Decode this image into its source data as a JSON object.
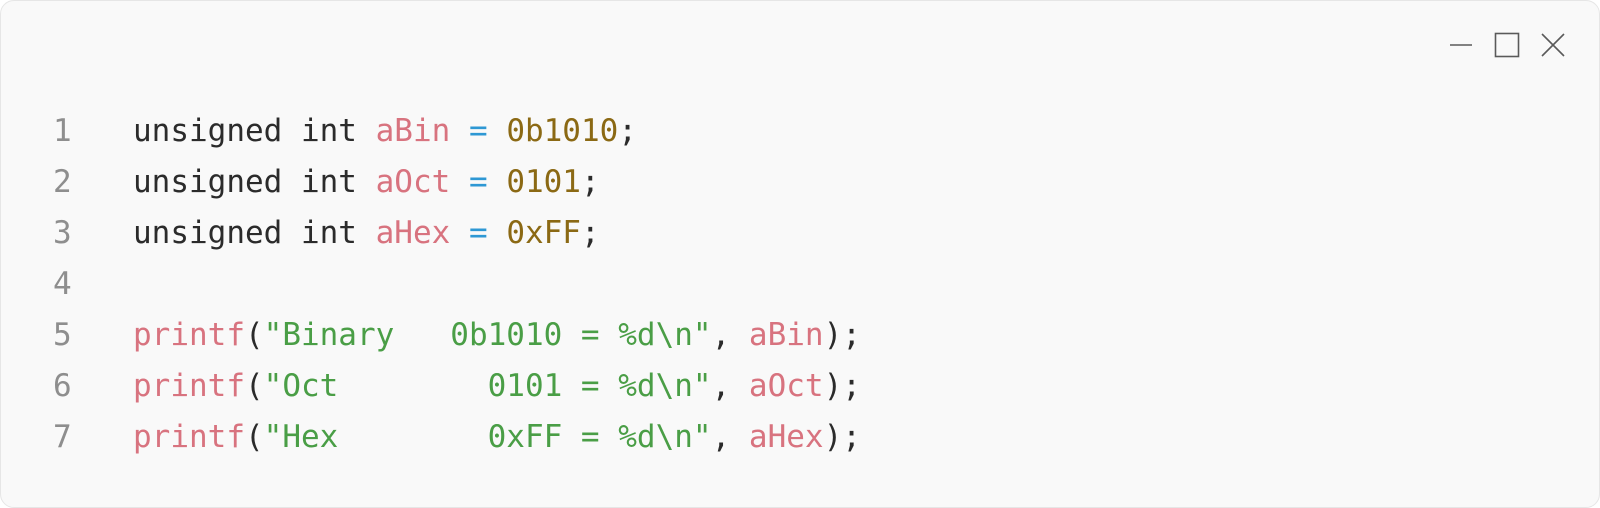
{
  "window": {
    "controls": {
      "minimize_icon": "minimize-icon",
      "maximize_icon": "maximize-icon",
      "close_icon": "close-icon"
    }
  },
  "editor": {
    "language": "C",
    "lines": [
      {
        "number": "1",
        "tokens": [
          {
            "text": "unsigned int ",
            "kind": "plain"
          },
          {
            "text": "aBin",
            "kind": "var"
          },
          {
            "text": " ",
            "kind": "plain"
          },
          {
            "text": "=",
            "kind": "op"
          },
          {
            "text": " ",
            "kind": "plain"
          },
          {
            "text": "0b1010",
            "kind": "num"
          },
          {
            "text": ";",
            "kind": "plain"
          }
        ]
      },
      {
        "number": "2",
        "tokens": [
          {
            "text": "unsigned int ",
            "kind": "plain"
          },
          {
            "text": "aOct",
            "kind": "var"
          },
          {
            "text": " ",
            "kind": "plain"
          },
          {
            "text": "=",
            "kind": "op"
          },
          {
            "text": " ",
            "kind": "plain"
          },
          {
            "text": "0101",
            "kind": "num"
          },
          {
            "text": ";",
            "kind": "plain"
          }
        ]
      },
      {
        "number": "3",
        "tokens": [
          {
            "text": "unsigned int ",
            "kind": "plain"
          },
          {
            "text": "aHex",
            "kind": "var"
          },
          {
            "text": " ",
            "kind": "plain"
          },
          {
            "text": "=",
            "kind": "op"
          },
          {
            "text": " ",
            "kind": "plain"
          },
          {
            "text": "0xFF",
            "kind": "num"
          },
          {
            "text": ";",
            "kind": "plain"
          }
        ]
      },
      {
        "number": "4",
        "tokens": []
      },
      {
        "number": "5",
        "tokens": [
          {
            "text": "printf",
            "kind": "fn"
          },
          {
            "text": "(",
            "kind": "plain"
          },
          {
            "text": "\"Binary   0b1010 = %d\\n\"",
            "kind": "str"
          },
          {
            "text": ", ",
            "kind": "plain"
          },
          {
            "text": "aBin",
            "kind": "var"
          },
          {
            "text": ");",
            "kind": "plain"
          }
        ]
      },
      {
        "number": "6",
        "tokens": [
          {
            "text": "printf",
            "kind": "fn"
          },
          {
            "text": "(",
            "kind": "plain"
          },
          {
            "text": "\"Oct        0101 = %d\\n\"",
            "kind": "str"
          },
          {
            "text": ", ",
            "kind": "plain"
          },
          {
            "text": "aOct",
            "kind": "var"
          },
          {
            "text": ");",
            "kind": "plain"
          }
        ]
      },
      {
        "number": "7",
        "tokens": [
          {
            "text": "printf",
            "kind": "fn"
          },
          {
            "text": "(",
            "kind": "plain"
          },
          {
            "text": "\"Hex        0xFF = %d\\n\"",
            "kind": "str"
          },
          {
            "text": ", ",
            "kind": "plain"
          },
          {
            "text": "aHex",
            "kind": "var"
          },
          {
            "text": ");",
            "kind": "plain"
          }
        ]
      }
    ]
  },
  "colors": {
    "background": "#f9f9f9",
    "plain": "#2b2b2b",
    "line_number": "#8e8e8e",
    "variable": "#d8737f",
    "operator": "#2e98d4",
    "number": "#8b6914",
    "function": "#d8737f",
    "string": "#4a9e46"
  }
}
